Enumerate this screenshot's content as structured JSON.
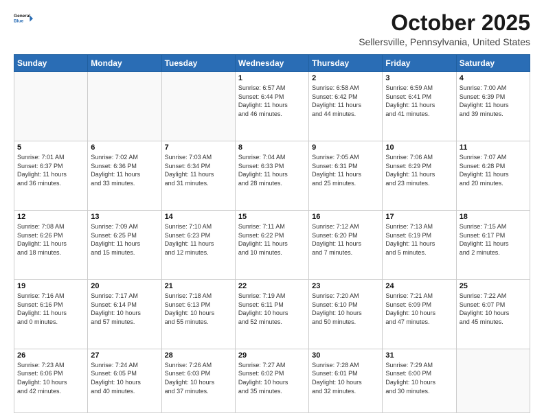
{
  "header": {
    "logo_general": "General",
    "logo_blue": "Blue",
    "month_title": "October 2025",
    "location": "Sellersville, Pennsylvania, United States"
  },
  "days_of_week": [
    "Sunday",
    "Monday",
    "Tuesday",
    "Wednesday",
    "Thursday",
    "Friday",
    "Saturday"
  ],
  "weeks": [
    [
      {
        "day": "",
        "info": ""
      },
      {
        "day": "",
        "info": ""
      },
      {
        "day": "",
        "info": ""
      },
      {
        "day": "1",
        "info": "Sunrise: 6:57 AM\nSunset: 6:44 PM\nDaylight: 11 hours\nand 46 minutes."
      },
      {
        "day": "2",
        "info": "Sunrise: 6:58 AM\nSunset: 6:42 PM\nDaylight: 11 hours\nand 44 minutes."
      },
      {
        "day": "3",
        "info": "Sunrise: 6:59 AM\nSunset: 6:41 PM\nDaylight: 11 hours\nand 41 minutes."
      },
      {
        "day": "4",
        "info": "Sunrise: 7:00 AM\nSunset: 6:39 PM\nDaylight: 11 hours\nand 39 minutes."
      }
    ],
    [
      {
        "day": "5",
        "info": "Sunrise: 7:01 AM\nSunset: 6:37 PM\nDaylight: 11 hours\nand 36 minutes."
      },
      {
        "day": "6",
        "info": "Sunrise: 7:02 AM\nSunset: 6:36 PM\nDaylight: 11 hours\nand 33 minutes."
      },
      {
        "day": "7",
        "info": "Sunrise: 7:03 AM\nSunset: 6:34 PM\nDaylight: 11 hours\nand 31 minutes."
      },
      {
        "day": "8",
        "info": "Sunrise: 7:04 AM\nSunset: 6:33 PM\nDaylight: 11 hours\nand 28 minutes."
      },
      {
        "day": "9",
        "info": "Sunrise: 7:05 AM\nSunset: 6:31 PM\nDaylight: 11 hours\nand 25 minutes."
      },
      {
        "day": "10",
        "info": "Sunrise: 7:06 AM\nSunset: 6:29 PM\nDaylight: 11 hours\nand 23 minutes."
      },
      {
        "day": "11",
        "info": "Sunrise: 7:07 AM\nSunset: 6:28 PM\nDaylight: 11 hours\nand 20 minutes."
      }
    ],
    [
      {
        "day": "12",
        "info": "Sunrise: 7:08 AM\nSunset: 6:26 PM\nDaylight: 11 hours\nand 18 minutes."
      },
      {
        "day": "13",
        "info": "Sunrise: 7:09 AM\nSunset: 6:25 PM\nDaylight: 11 hours\nand 15 minutes."
      },
      {
        "day": "14",
        "info": "Sunrise: 7:10 AM\nSunset: 6:23 PM\nDaylight: 11 hours\nand 12 minutes."
      },
      {
        "day": "15",
        "info": "Sunrise: 7:11 AM\nSunset: 6:22 PM\nDaylight: 11 hours\nand 10 minutes."
      },
      {
        "day": "16",
        "info": "Sunrise: 7:12 AM\nSunset: 6:20 PM\nDaylight: 11 hours\nand 7 minutes."
      },
      {
        "day": "17",
        "info": "Sunrise: 7:13 AM\nSunset: 6:19 PM\nDaylight: 11 hours\nand 5 minutes."
      },
      {
        "day": "18",
        "info": "Sunrise: 7:15 AM\nSunset: 6:17 PM\nDaylight: 11 hours\nand 2 minutes."
      }
    ],
    [
      {
        "day": "19",
        "info": "Sunrise: 7:16 AM\nSunset: 6:16 PM\nDaylight: 11 hours\nand 0 minutes."
      },
      {
        "day": "20",
        "info": "Sunrise: 7:17 AM\nSunset: 6:14 PM\nDaylight: 10 hours\nand 57 minutes."
      },
      {
        "day": "21",
        "info": "Sunrise: 7:18 AM\nSunset: 6:13 PM\nDaylight: 10 hours\nand 55 minutes."
      },
      {
        "day": "22",
        "info": "Sunrise: 7:19 AM\nSunset: 6:11 PM\nDaylight: 10 hours\nand 52 minutes."
      },
      {
        "day": "23",
        "info": "Sunrise: 7:20 AM\nSunset: 6:10 PM\nDaylight: 10 hours\nand 50 minutes."
      },
      {
        "day": "24",
        "info": "Sunrise: 7:21 AM\nSunset: 6:09 PM\nDaylight: 10 hours\nand 47 minutes."
      },
      {
        "day": "25",
        "info": "Sunrise: 7:22 AM\nSunset: 6:07 PM\nDaylight: 10 hours\nand 45 minutes."
      }
    ],
    [
      {
        "day": "26",
        "info": "Sunrise: 7:23 AM\nSunset: 6:06 PM\nDaylight: 10 hours\nand 42 minutes."
      },
      {
        "day": "27",
        "info": "Sunrise: 7:24 AM\nSunset: 6:05 PM\nDaylight: 10 hours\nand 40 minutes."
      },
      {
        "day": "28",
        "info": "Sunrise: 7:26 AM\nSunset: 6:03 PM\nDaylight: 10 hours\nand 37 minutes."
      },
      {
        "day": "29",
        "info": "Sunrise: 7:27 AM\nSunset: 6:02 PM\nDaylight: 10 hours\nand 35 minutes."
      },
      {
        "day": "30",
        "info": "Sunrise: 7:28 AM\nSunset: 6:01 PM\nDaylight: 10 hours\nand 32 minutes."
      },
      {
        "day": "31",
        "info": "Sunrise: 7:29 AM\nSunset: 6:00 PM\nDaylight: 10 hours\nand 30 minutes."
      },
      {
        "day": "",
        "info": ""
      }
    ]
  ]
}
